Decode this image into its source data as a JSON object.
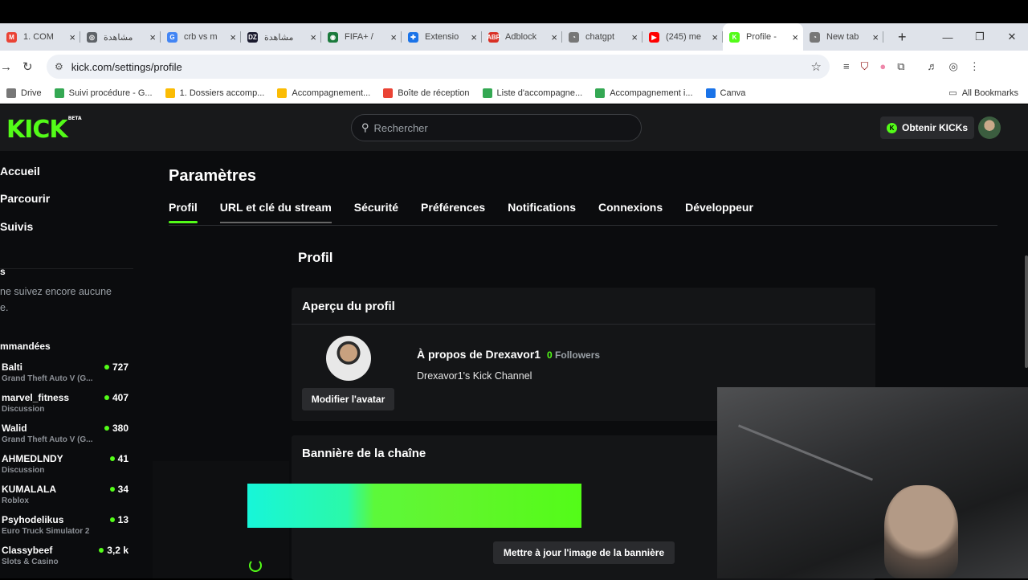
{
  "browser": {
    "tabs": [
      {
        "title": "1. COM",
        "color": "#ea4335",
        "glyph": "M"
      },
      {
        "title": "مشاهدة",
        "color": "#5f6368",
        "glyph": "◎"
      },
      {
        "title": "crb vs m",
        "color": "#4285f4",
        "glyph": "G"
      },
      {
        "title": "مشاهدة",
        "color": "#1a1a2e",
        "glyph": "DZ"
      },
      {
        "title": "FIFA+ / ",
        "color": "#1b7a3c",
        "glyph": "◉"
      },
      {
        "title": "Extensio",
        "color": "#1a73e8",
        "glyph": "✚"
      },
      {
        "title": "Adblock",
        "color": "#d93025",
        "glyph": "ABP"
      },
      {
        "title": "chatgpt",
        "color": "#777",
        "glyph": "◔"
      },
      {
        "title": "(245) me",
        "color": "#ff0000",
        "glyph": "▶"
      },
      {
        "title": "Profile -",
        "color": "#53fc18",
        "glyph": "K",
        "active": true
      },
      {
        "title": "New tab",
        "color": "#777",
        "glyph": "◔"
      }
    ],
    "url": "kick.com/settings/profile",
    "bookmarks": [
      {
        "label": "Drive",
        "color": "#777"
      },
      {
        "label": "Suivi procédure - G...",
        "color": "#34a853"
      },
      {
        "label": "1. Dossiers accomp...",
        "color": "#fbbc04"
      },
      {
        "label": "Accompagnement...",
        "color": "#fbbc04"
      },
      {
        "label": "Boîte de réception",
        "color": "#ea4335"
      },
      {
        "label": "Liste d'accompagne...",
        "color": "#34a853"
      },
      {
        "label": "Accompagnement i...",
        "color": "#34a853"
      },
      {
        "label": "Canva",
        "color": "#1a73e8"
      }
    ],
    "all_bookmarks": "All Bookmarks"
  },
  "site": {
    "logo": "KICK",
    "logo_badge": "BETA",
    "search_placeholder": "Rechercher",
    "kicks_button": "Obtenir KICKs",
    "accent": "#53fc18"
  },
  "sidebar": {
    "nav": [
      "Accueil",
      "Parcourir",
      "Suivis"
    ],
    "following_title": "s",
    "following_empty": "ne suivez encore aucune",
    "following_empty2": "e.",
    "recommended_title": "mmandées",
    "channels": [
      {
        "name": "Balti",
        "game": "Grand Theft Auto V (G...",
        "viewers": "727"
      },
      {
        "name": "marvel_fitness",
        "game": "Discussion",
        "viewers": "407"
      },
      {
        "name": "Walid",
        "game": "Grand Theft Auto V (G...",
        "viewers": "380"
      },
      {
        "name": "AHMEDLNDY",
        "game": "Discussion",
        "viewers": "41"
      },
      {
        "name": "KUMALALA",
        "game": "Roblox",
        "viewers": "34"
      },
      {
        "name": "Psyhodelikus",
        "game": "Euro Truck Simulator 2",
        "viewers": "13"
      },
      {
        "name": "Classybeef",
        "game": "Slots & Casino",
        "viewers": "3,2 k"
      }
    ]
  },
  "settings": {
    "title": "Paramètres",
    "tabs": [
      "Profil",
      "URL et clé du stream",
      "Sécurité",
      "Préférences",
      "Notifications",
      "Connexions",
      "Développeur"
    ],
    "section_title": "Profil",
    "preview": {
      "heading": "Aperçu du profil",
      "about": "À propos de Drexavor1",
      "followers_count": "0",
      "followers_label": "Followers",
      "description": "Drexavor1's Kick Channel",
      "edit_avatar": "Modifier l'avatar"
    },
    "banner": {
      "heading": "Bannière de la chaîne",
      "update_button": "Mettre à jour l'image de la bannière"
    }
  }
}
